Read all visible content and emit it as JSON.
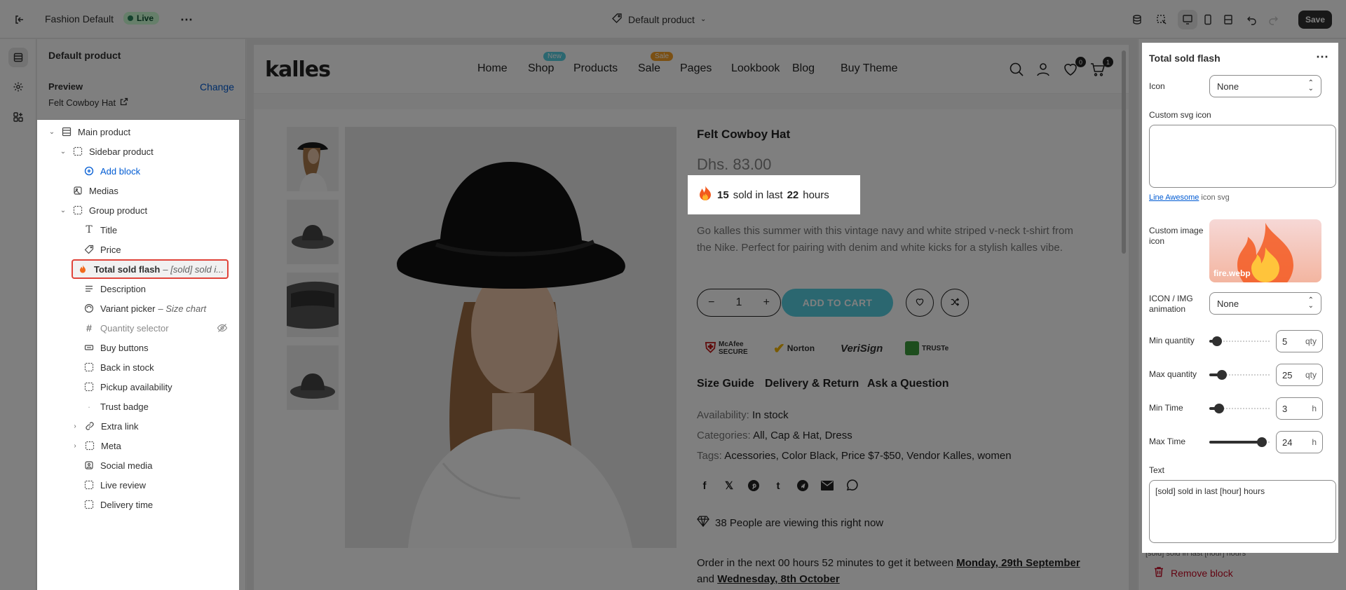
{
  "topbar": {
    "theme_name": "Fashion Default",
    "live_label": "Live",
    "template_label": "Default product",
    "save_label": "Save"
  },
  "left_panel": {
    "title": "Default product",
    "preview_label": "Preview",
    "change_label": "Change",
    "preview_product": "Felt Cowboy Hat",
    "tree": [
      {
        "label": "Main product",
        "icon": "section-icon"
      },
      {
        "label": "Sidebar product",
        "icon": "group-icon"
      },
      {
        "label": "Add block",
        "icon": "plus-circle-icon"
      },
      {
        "label": "Medias",
        "icon": "media-icon"
      },
      {
        "label": "Group product",
        "icon": "group-icon"
      },
      {
        "label": "Title",
        "icon": "text-icon"
      },
      {
        "label": "Price",
        "icon": "price-tag-icon"
      },
      {
        "label": "Total sold flash",
        "suffix": "– [sold] sold i...",
        "icon": "fire-icon"
      },
      {
        "label": "Description",
        "icon": "paragraph-icon"
      },
      {
        "label": "Variant picker",
        "suffix": "– Size chart",
        "icon": "variant-icon"
      },
      {
        "label": "Quantity selector",
        "icon": "hash-icon"
      },
      {
        "label": "Buy buttons",
        "icon": "buy-icon"
      },
      {
        "label": "Back in stock",
        "icon": "group-icon"
      },
      {
        "label": "Pickup availability",
        "icon": "group-icon"
      },
      {
        "label": "Trust badge",
        "icon": "dot-icon"
      },
      {
        "label": "Extra link",
        "icon": "link-icon"
      },
      {
        "label": "Meta",
        "icon": "group-icon"
      },
      {
        "label": "Social media",
        "icon": "image-icon"
      },
      {
        "label": "Live review",
        "icon": "group-icon"
      },
      {
        "label": "Delivery time",
        "icon": "group-icon"
      }
    ]
  },
  "store": {
    "logo": "kalles",
    "nav": [
      "Home",
      "Shop",
      "Products",
      "Sale",
      "Pages",
      "Lookbook",
      "Blog",
      "Buy Theme"
    ],
    "badge_new": "New",
    "badge_sale": "Sale",
    "wishlist_count": "0",
    "cart_count": "1",
    "product_title": "Felt Cowboy Hat",
    "price": "Dhs. 83.00",
    "flash_count": "15",
    "flash_mid": "sold in last",
    "flash_hours": "22",
    "flash_end": "hours",
    "description": "Go kalles this summer with this vintage navy and white striped v-neck t-shirt from the Nike. Perfect for pairing with denim and white kicks for a stylish kalles vibe.",
    "quantity": "1",
    "add_to_cart": "ADD TO CART",
    "trust": [
      "McAfee SECURE",
      "Norton",
      "VeriSign",
      "TRUSTe"
    ],
    "tabs": [
      "Size Guide",
      "Delivery & Return",
      "Ask a Question"
    ],
    "availability_key": "Availability:",
    "availability_val": "In stock",
    "categories_key": "Categories:",
    "categories_val": "All, Cap & Hat, Dress",
    "tags_key": "Tags:",
    "tags_val": "Acessories, Color Black, Price $7-$50, Vendor Kalles, women",
    "viewing": "38 People are viewing this right now",
    "order_prefix": "Order in the next 00 hours 52 minutes to get it between",
    "order_date1": "Monday, 29th September",
    "order_and": "and",
    "order_date2": "Wednesday, 8th October"
  },
  "right_panel": {
    "title": "Total sold flash",
    "icon_label": "Icon",
    "icon_value": "None",
    "custom_svg_label": "Custom svg icon",
    "line_awesome": "Line Awesome",
    "icon_svg_hint": "icon svg",
    "custom_image_label": "Custom image icon",
    "image_file": "fire.webp",
    "anim_label": "ICON / IMG animation",
    "anim_value": "None",
    "min_qty_label": "Min quantity",
    "min_qty": "5",
    "max_qty_label": "Max quantity",
    "max_qty": "25",
    "qty_unit": "qty",
    "min_time_label": "Min Time",
    "min_time": "3",
    "max_time_label": "Max Time",
    "max_time": "24",
    "time_unit": "h",
    "text_label": "Text",
    "text_value": "[sold] sold in last [hour] hours",
    "text_hint": "[sold] sold in last [hour] hours",
    "remove_label": "Remove block",
    "slider_levels": {
      "min_qty": 0.05,
      "max_qty": 0.15,
      "min_time": 0.1,
      "max_time": 0.95
    }
  }
}
